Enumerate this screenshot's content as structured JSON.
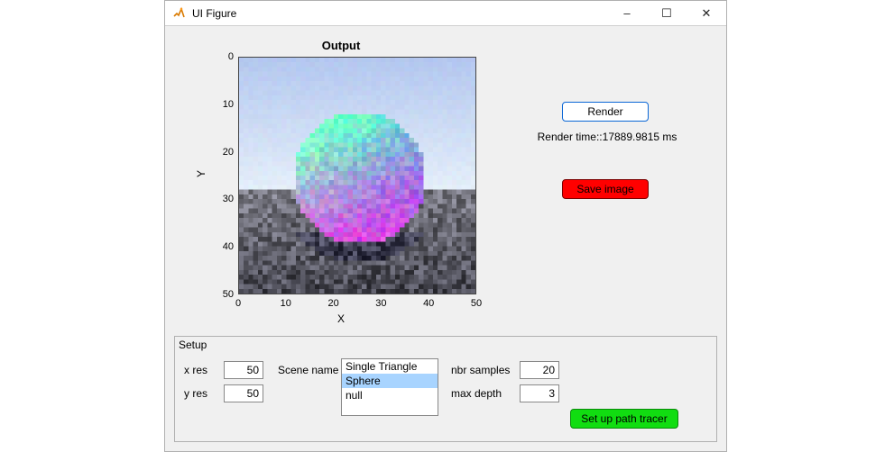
{
  "window": {
    "title": "UI Figure",
    "minimize": "–",
    "maximize": "☐",
    "close": "✕"
  },
  "controls": {
    "render_label": "Render",
    "status_text": "Render time::17889.9815 ms",
    "save_label": "Save image",
    "setup_button_label": "Set up path tracer"
  },
  "setup": {
    "panel_title": "Setup",
    "xres_label": "x res",
    "xres_value": "50",
    "yres_label": "y res",
    "yres_value": "50",
    "scene_label": "Scene name",
    "scene_options": [
      "Single Triangle",
      "Sphere",
      "null"
    ],
    "scene_selected_index": 1,
    "nbr_samples_label": "nbr samples",
    "nbr_samples_value": "20",
    "max_depth_label": "max depth",
    "max_depth_value": "3"
  },
  "chart_data": {
    "type": "heatmap",
    "title": "Output",
    "xlabel": "X",
    "ylabel": "Y",
    "xlim": [
      0,
      50
    ],
    "ylim": [
      0,
      50
    ],
    "xticks": [
      0,
      10,
      20,
      30,
      40,
      50
    ],
    "yticks": [
      0,
      10,
      20,
      30,
      40,
      50
    ],
    "y_reversed": true,
    "description": "Path-traced render of a Sphere scene: a blue-to-purple shaded sphere centered around (25,25) on a noisy dark-grey ground plane with pale blue sky above the horizon near y≈28.",
    "image_grid": {
      "width": 50,
      "height": 50,
      "sphere_center": [
        25,
        25
      ],
      "sphere_radius": 14,
      "horizon_y": 28
    }
  }
}
